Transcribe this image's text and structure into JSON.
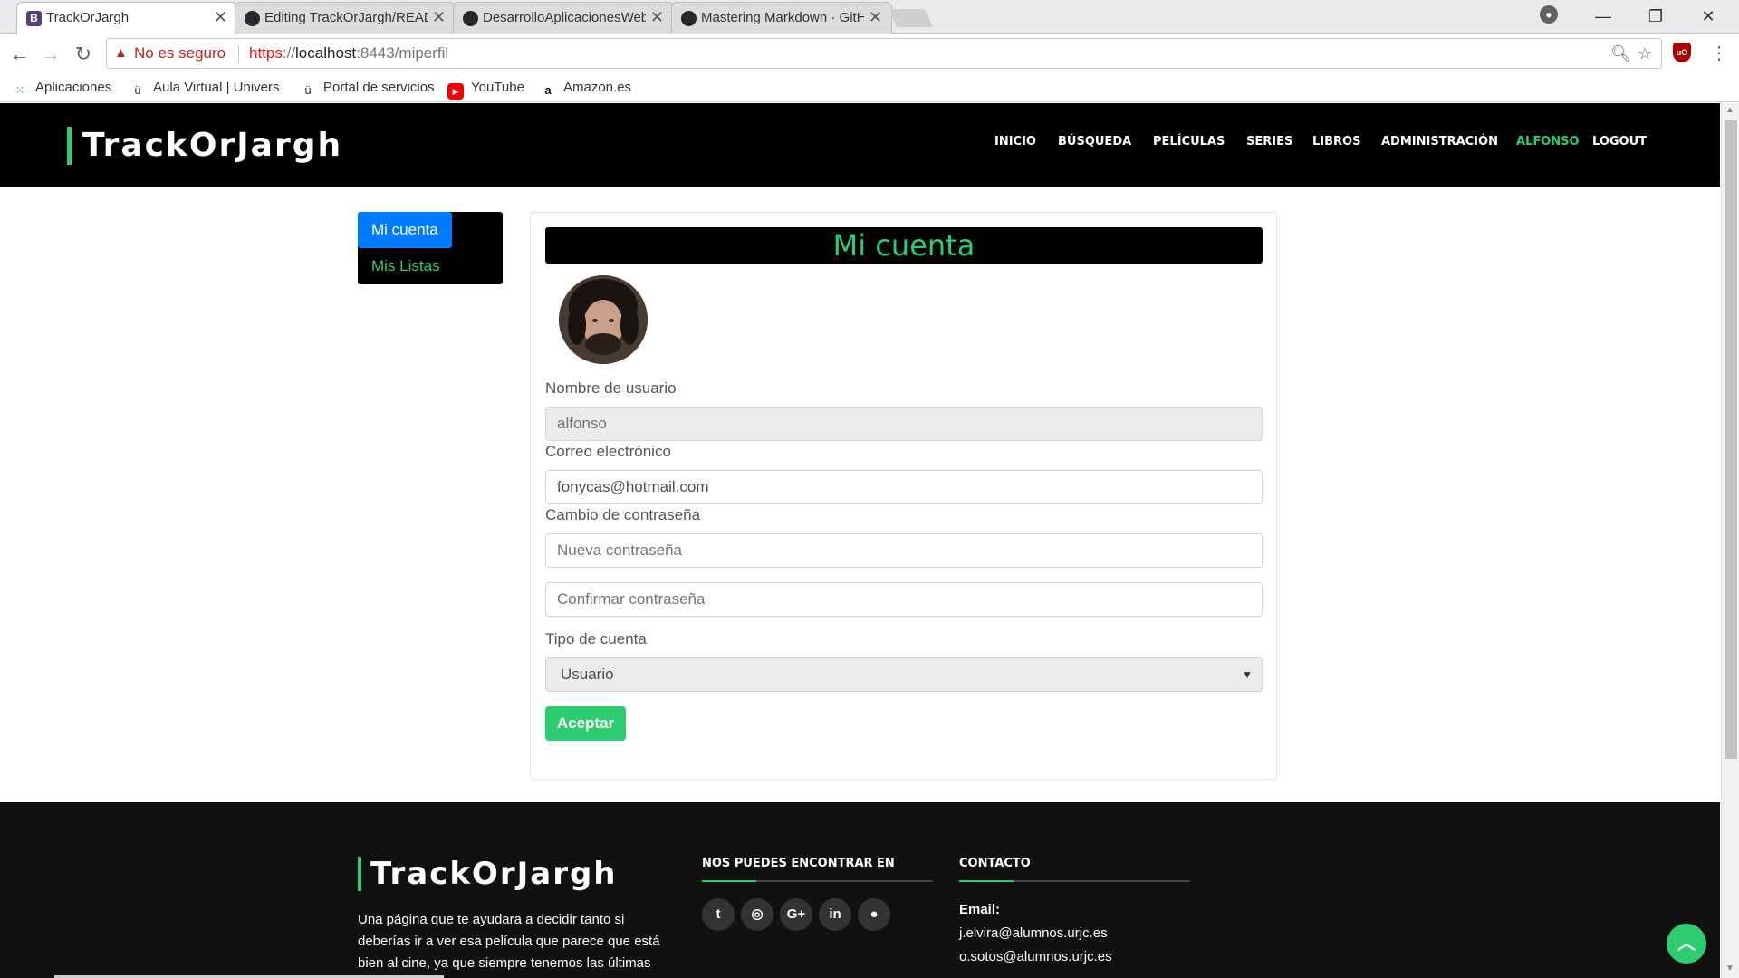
{
  "browser": {
    "tabs": [
      {
        "title": "TrackOrJargh",
        "favicon": "bootstrap-favicon",
        "active": true
      },
      {
        "title": "Editing TrackOrJargh/README.md",
        "favicon": "github-favicon",
        "active": false
      },
      {
        "title": "DesarrolloAplicacionesWeb",
        "favicon": "github-favicon",
        "active": false
      },
      {
        "title": "Mastering Markdown · GitHub",
        "favicon": "github-favicon",
        "active": false
      }
    ],
    "security_text": "No es seguro",
    "url_scheme": "https",
    "url_sep": "://",
    "url_host": "localhost",
    "url_rest": ":8443/miperfil",
    "bookmarks": [
      {
        "label": "Aplicaciones",
        "icon": "apps-grid-icon"
      },
      {
        "label": "Aula Virtual | Universidad",
        "icon": "urjc-icon"
      },
      {
        "label": "Portal de servicios",
        "icon": "urjc-icon"
      },
      {
        "label": "YouTube",
        "icon": "youtube-icon"
      },
      {
        "label": "Amazon.es",
        "icon": "amazon-icon"
      }
    ]
  },
  "site": {
    "brand": "TrackOrJargh",
    "nav": [
      "INICIO",
      "BÚSQUEDA",
      "PELÍCULAS",
      "SERIES",
      "LIBROS",
      "ADMINISTRACIÓN",
      "ALFONSO",
      "LOGOUT"
    ],
    "accent_color": "#2ecc71"
  },
  "side_menu": {
    "items": [
      "Mi cuenta",
      "Mis Listas"
    ],
    "active": "Mi cuenta"
  },
  "profile": {
    "title": "Mi cuenta",
    "username_label": "Nombre de usuario",
    "username_value": "alfonso",
    "email_label": "Correo electrónico",
    "email_value": "fonycas@hotmail.com",
    "password_label": "Cambio de contraseña",
    "new_password_placeholder": "Nueva contraseña",
    "confirm_password_placeholder": "Confirmar contraseña",
    "account_type_label": "Tipo de cuenta",
    "account_type_value": "Usuario",
    "submit_label": "Aceptar"
  },
  "footer": {
    "brand": "TrackOrJargh",
    "description": "Una página que te ayudara a decidir tanto si deberías ir a ver esa película que parece que está bien al cine, ya que siempre tenemos las últimas",
    "social_heading": "NOS PUEDES ENCONTRAR EN",
    "social_icons": [
      "twitter-icon",
      "instagram-icon",
      "google-plus-icon",
      "linkedin-icon",
      "github-icon"
    ],
    "contact_heading": "CONTACTO",
    "email_label": "Email:",
    "emails": [
      "j.elvira@alumnos.urjc.es",
      "o.sotos@alumnos.urjc.es"
    ]
  }
}
